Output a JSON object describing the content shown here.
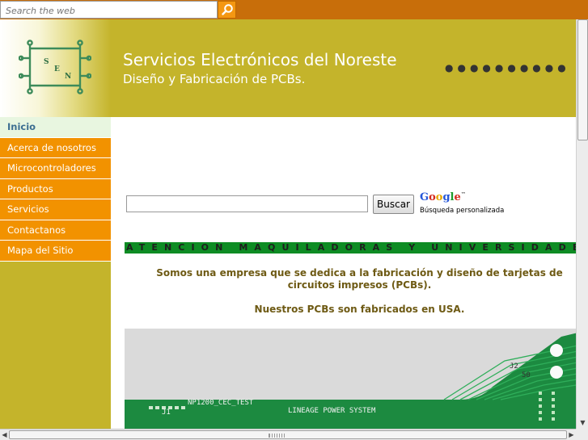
{
  "search": {
    "placeholder": "Search the web"
  },
  "header": {
    "title": "Servicios Electrónicos del Noreste",
    "subtitle": "Diseño y Fabricación de PCBs.",
    "dots": "●●●●●●●●●●",
    "logo_letters": [
      "S",
      "E",
      "N"
    ]
  },
  "nav": {
    "items": [
      {
        "label": "Inicio"
      },
      {
        "label": "Acerca de nosotros"
      },
      {
        "label": "Microcontroladores"
      },
      {
        "label": "Productos"
      },
      {
        "label": "Servicios"
      },
      {
        "label": "Contactanos"
      },
      {
        "label": "Mapa del Sitio"
      }
    ]
  },
  "google_search": {
    "button_label": "Buscar",
    "logo_text": "Google",
    "trademark": "™",
    "caption": "Búsqueda personalizada"
  },
  "content": {
    "banner": "ATENCION  MAQUILADORAS  Y  UNIVERSIDADES  !!!",
    "intro": "Somos una empresa que se dedica a la fabricación y diseño de tarjetas de circuitos impresos (PCBs).",
    "made_in": "Nuestros PCBs son fabricados en USA."
  },
  "pcb_photo": {
    "label_np": "NP1200_CEC_TEST",
    "label_j1": "J1",
    "label_lineage": "LINEAGE POWER SYSTEM",
    "label_j2": "J2",
    "label_50": "50"
  },
  "colors": {
    "topbar": "#c86e0a",
    "header": "#c4b42b",
    "nav_orange": "#f29200",
    "nav_active_bg": "#e8f6e0",
    "banner_green": "#0e8c24",
    "intro_text": "#6e5a14",
    "pcb_green": "#1c8a40"
  },
  "icons": {
    "search": "search-icon"
  }
}
